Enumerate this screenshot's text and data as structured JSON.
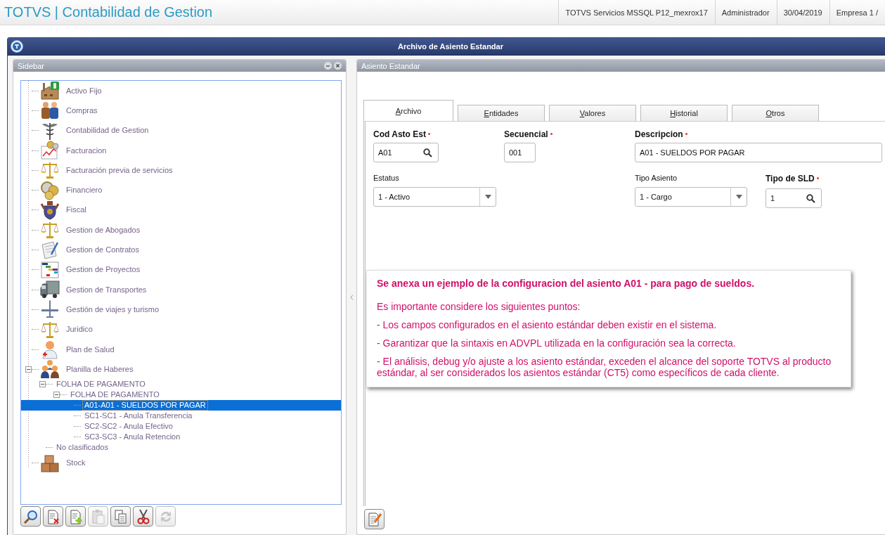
{
  "header": {
    "app_title": "TOTVS | Contabilidad de Gestion",
    "info": [
      "TOTVS Servicios MSSQL P12_mexrox17",
      "Administrador",
      "30/04/2019",
      "Empresa 1 /"
    ]
  },
  "window": {
    "title": "Archivo de Asiento Estandar"
  },
  "sidebar": {
    "title": "Sidebar",
    "tree": [
      {
        "label": "Activo Fijo",
        "selected": false
      },
      {
        "label": "Compras",
        "selected": false
      },
      {
        "label": "Contabilidad de Gestion",
        "selected": false
      },
      {
        "label": "Facturacion",
        "selected": false
      },
      {
        "label": "Facturación previa de servicios",
        "selected": false
      },
      {
        "label": "Financiero",
        "selected": false
      },
      {
        "label": "Fiscal",
        "selected": false
      },
      {
        "label": "Gestion de Abogados",
        "selected": false
      },
      {
        "label": "Gestion de Contratos",
        "selected": false
      },
      {
        "label": "Gestion de Proyectos",
        "selected": false
      },
      {
        "label": "Gestion de Transportes",
        "selected": false
      },
      {
        "label": "Gestión de viajes y turismo",
        "selected": false
      },
      {
        "label": "Juridico",
        "selected": false
      },
      {
        "label": "Plan de Salud",
        "selected": false
      },
      {
        "label": "Planilla de Haberes",
        "selected": false,
        "expanded": true,
        "children": [
          {
            "label": "FOLHA DE PAGAMENTO",
            "selected": false,
            "expanded": true,
            "children": [
              {
                "label": "FOLHA DE PAGAMENTO",
                "selected": false,
                "expanded": true,
                "children": [
                  {
                    "label": "A01-A01 - SUELDOS POR PAGAR",
                    "selected": true
                  },
                  {
                    "label": "SC1-SC1 - Anula Transferencia",
                    "selected": false
                  },
                  {
                    "label": "SC2-SC2 - Anula Efectivo",
                    "selected": false
                  },
                  {
                    "label": "SC3-SC3 - Anula Retencion",
                    "selected": false
                  }
                ]
              }
            ]
          },
          {
            "label": "No clasificados",
            "selected": false
          }
        ]
      },
      {
        "label": "Stock",
        "selected": false
      }
    ],
    "toolbar": [
      {
        "kind": "search",
        "disabled": false
      },
      {
        "kind": "delete",
        "disabled": false
      },
      {
        "kind": "add",
        "disabled": false
      },
      {
        "kind": "paste",
        "disabled": true
      },
      {
        "kind": "copy",
        "disabled": false
      },
      {
        "kind": "cut",
        "disabled": false
      },
      {
        "kind": "refresh",
        "disabled": true
      }
    ]
  },
  "main": {
    "title": "Asiento Estandar",
    "tabs": [
      {
        "label": "Archivo",
        "selected": true
      },
      {
        "label": "Entidades",
        "selected": false
      },
      {
        "label": "Valores",
        "selected": false
      },
      {
        "label": "Historial",
        "selected": false
      },
      {
        "label": "Otros",
        "selected": false
      }
    ],
    "fields": [
      [
        {
          "label": "Cod Asto Est",
          "required": true,
          "kind": "lookup",
          "value": "A01"
        },
        {
          "label": "Secuencial",
          "required": true,
          "kind": "text",
          "value": "001"
        },
        {
          "label": "Descripcion",
          "required": true,
          "kind": "text",
          "value": "A01 - SUELDOS POR PAGAR"
        }
      ],
      [
        {
          "label": "Estatus",
          "required": false,
          "kind": "select",
          "value": "1 - Activo"
        },
        {
          "label": "Tipo Asiento",
          "required": false,
          "kind": "select",
          "value": "1 - Cargo"
        },
        {
          "label": "Tipo de SLD",
          "required": true,
          "kind": "lookup",
          "value": "1"
        }
      ]
    ],
    "note": {
      "heading": "Se anexa un ejemplo de la configuracion del asiento A01 - para pago de sueldos.",
      "paragraphs": [
        "Es importante considere los siguientes puntos:",
        "- Los campos configurados en el asiento estándar deben existir en el sistema.",
        "- Garantizar que la sintaxis en ADVPL utilizada en la configuración sea la correcta.",
        "- El análisis, debug y/o ajuste a los asiento estándar, exceden el alcance del soporte TOTVS al producto estándar, al ser considerados los asientos estándar (CT5) como específicos de cada cliente."
      ]
    },
    "toolbar": [
      {
        "kind": "edit",
        "disabled": false
      }
    ]
  }
}
